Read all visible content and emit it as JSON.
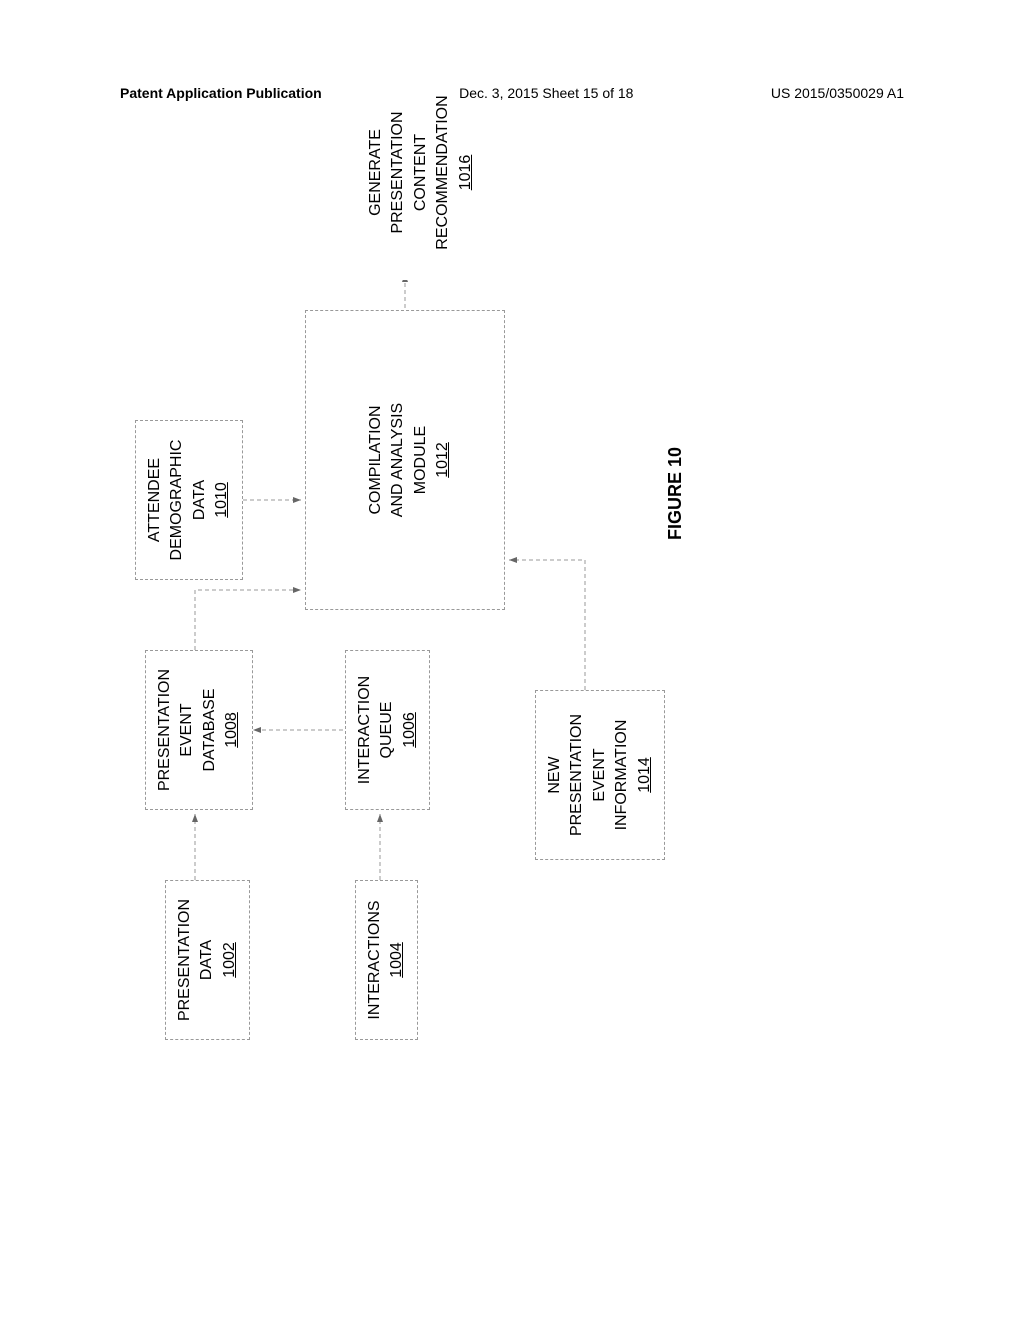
{
  "header": {
    "left": "Patent Application Publication",
    "center": "Dec. 3, 2015  Sheet 15 of 18",
    "right": "US 2015/0350029 A1"
  },
  "diagram": {
    "nodes": {
      "presentation_data": {
        "line1": "PRESENTATION",
        "line2": "DATA",
        "ref": "1002"
      },
      "interactions": {
        "line1": "INTERACTIONS",
        "ref": "1004"
      },
      "interaction_queue": {
        "line1": "INTERACTION",
        "line2": "QUEUE",
        "ref": "1006"
      },
      "presentation_event_db": {
        "line1": "PRESENTATION",
        "line2": "EVENT",
        "line3": "DATABASE",
        "ref": "1008"
      },
      "attendee_demo": {
        "line1": "ATTENDEE",
        "line2": "DEMOGRAPHIC",
        "line3": "DATA",
        "ref": "1010"
      },
      "compilation": {
        "line1": "COMPILATION",
        "line2": "AND ANALYSIS",
        "line3": "MODULE",
        "ref": "1012"
      },
      "new_event_info": {
        "line1": "NEW",
        "line2": "PRESENTATION",
        "line3": "EVENT",
        "line4": "INFORMATION",
        "ref": "1014"
      },
      "generate": {
        "line1": "GENERATE",
        "line2": "PRESENTATION",
        "line3": "CONTENT",
        "line4": "RECOMMENDATION",
        "ref": "1016"
      }
    },
    "caption": "FIGURE 10"
  }
}
